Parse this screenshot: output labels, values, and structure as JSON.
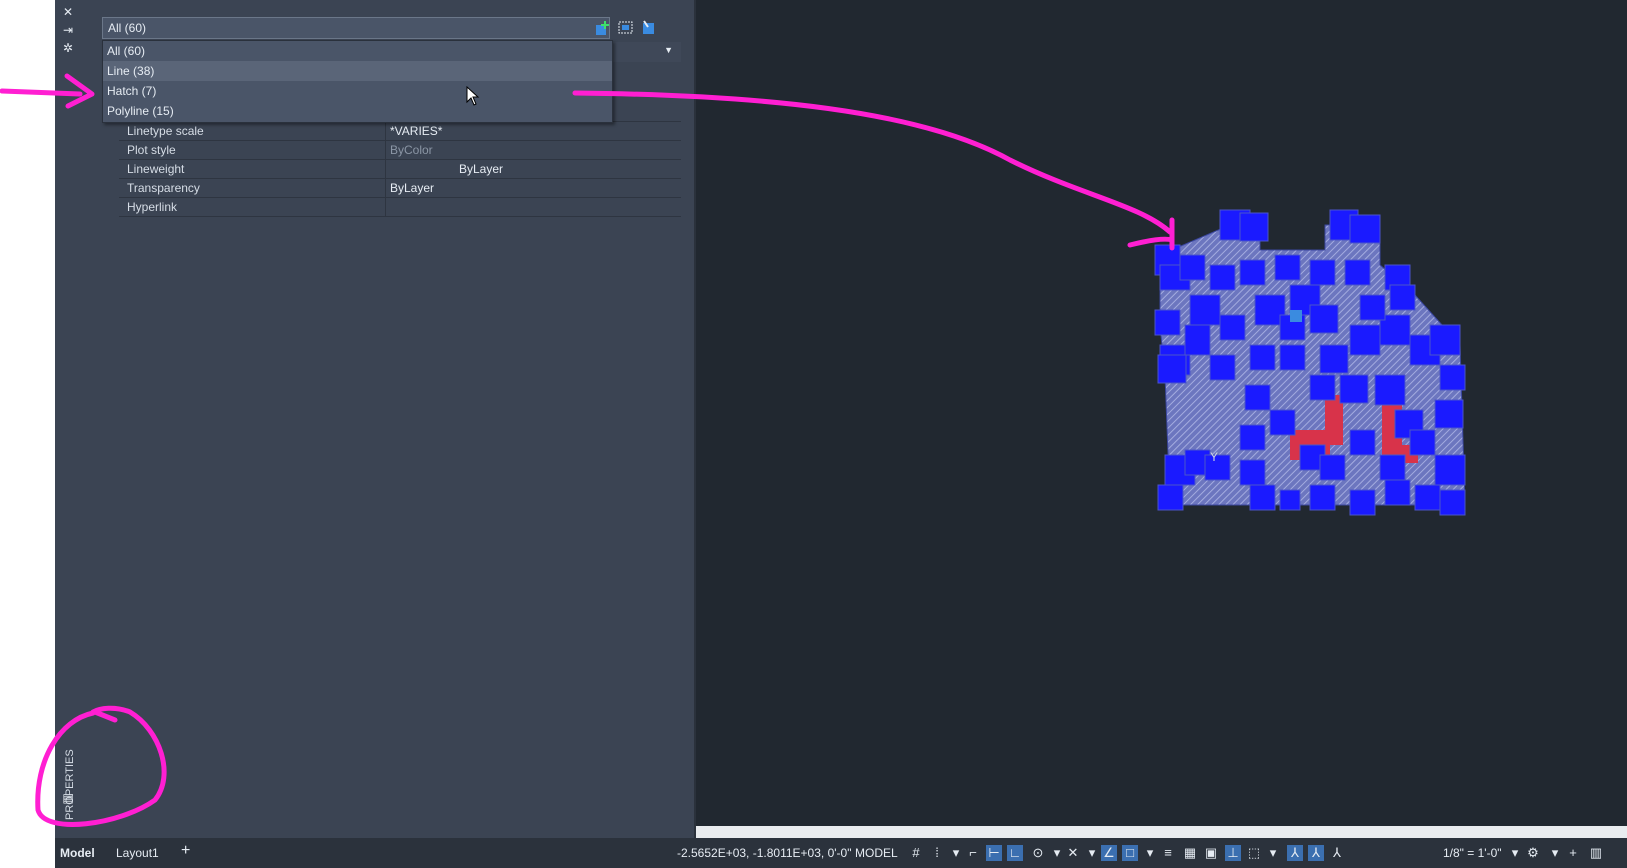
{
  "properties_panel": {
    "selection_combo": "All (60)",
    "dropdown_items": [
      {
        "label": "All (60)",
        "highlighted": false
      },
      {
        "label": "Line (38)",
        "highlighted": true
      },
      {
        "label": "Hatch (7)",
        "highlighted": false
      },
      {
        "label": "Polyline (15)",
        "highlighted": false
      }
    ],
    "vertical_title": "PROPERTIES",
    "properties": [
      {
        "name": "Linetype scale",
        "value": "*VARIES*"
      },
      {
        "name": "Plot style",
        "value": "ByColor"
      },
      {
        "name": "Lineweight",
        "value": "ByLayer"
      },
      {
        "name": "Transparency",
        "value": "ByLayer"
      },
      {
        "name": "Hyperlink",
        "value": ""
      }
    ]
  },
  "canvas": {
    "ucs_label": "Y"
  },
  "statusbar": {
    "tab_model": "Model",
    "tab_layout": "Layout1",
    "add_tab": "+",
    "coordinates": "-2.5652E+03, -1.8011E+03, 0'-0\"",
    "model_label": "MODEL",
    "scale": "1/8\" = 1'-0\""
  },
  "colors": {
    "canvas_bg": "#212830",
    "panel_bg": "#3b4453",
    "annotation": "#ff1fd2",
    "drawing_blue": "#1a1aff",
    "hatch": "#8a93d6",
    "highlight_red": "#d8334a"
  }
}
